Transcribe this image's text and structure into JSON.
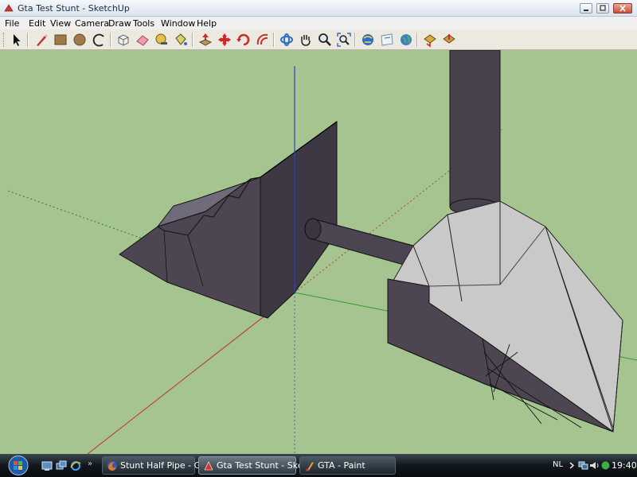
{
  "window": {
    "title": "Gta Test Stunt - SketchUp"
  },
  "menu": {
    "items": [
      "File",
      "Edit",
      "View",
      "Camera",
      "Draw",
      "Tools",
      "Window",
      "Help"
    ]
  },
  "toolbar": {
    "tools": [
      "select-tool",
      "pencil-tool",
      "rectangle-tool",
      "circle-tool",
      "arc-tool",
      "make-component-tool",
      "eraser-tool",
      "tape-measure-tool",
      "paint-bucket-tool",
      "push-pull-tool",
      "move-tool",
      "rotate-tool",
      "offset-tool",
      "orbit-tool",
      "pan-tool",
      "zoom-tool",
      "zoom-extents-tool",
      "get-models-tool",
      "share-model-tool",
      "google-earth-tool",
      "get-current-view-tool",
      "toggle-terrain-tool"
    ]
  },
  "viewport": {
    "ground_color": "#a6c48f",
    "shade_dark": "#4d4652",
    "shade_light": "#c9c9c9"
  },
  "taskbar": {
    "tasks": [
      {
        "label": "Stunt Half Pipe - GT...",
        "icon": "firefox-icon",
        "active": false
      },
      {
        "label": "Gta Test Stunt - Sket...",
        "icon": "sketchup-icon",
        "active": true
      },
      {
        "label": "GTA - Paint",
        "icon": "paint-icon",
        "active": false
      }
    ],
    "language": "NL",
    "clock": "19:40"
  }
}
